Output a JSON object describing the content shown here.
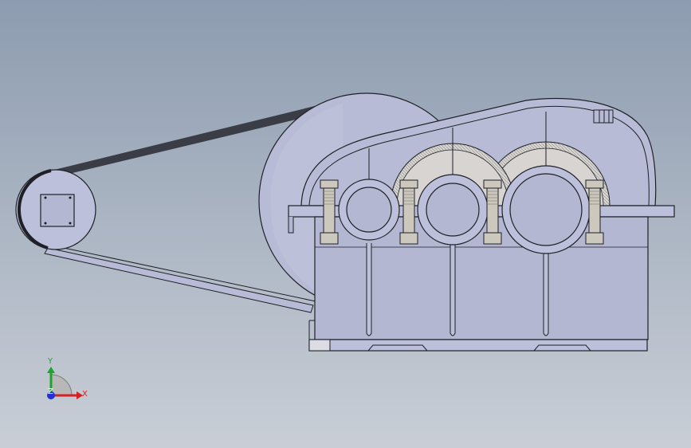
{
  "viewport": {
    "background_top": "#8d9cb0",
    "background_bottom": "#c9ced6"
  },
  "model": {
    "body_color": "#b3b7d2",
    "body_light": "#bcc0da",
    "cover_color": "#b7bbd5",
    "gear_color": "#d7d4d1",
    "bolt_color": "#cdc8bd",
    "belt_color": "#3a3d45",
    "edge_color": "#1e2026"
  },
  "triad": {
    "x_label": "X",
    "y_label": "Y",
    "z_label": "Z",
    "x_color": "#d42020",
    "y_color": "#1fa32a",
    "z_color": "#2230d6"
  }
}
